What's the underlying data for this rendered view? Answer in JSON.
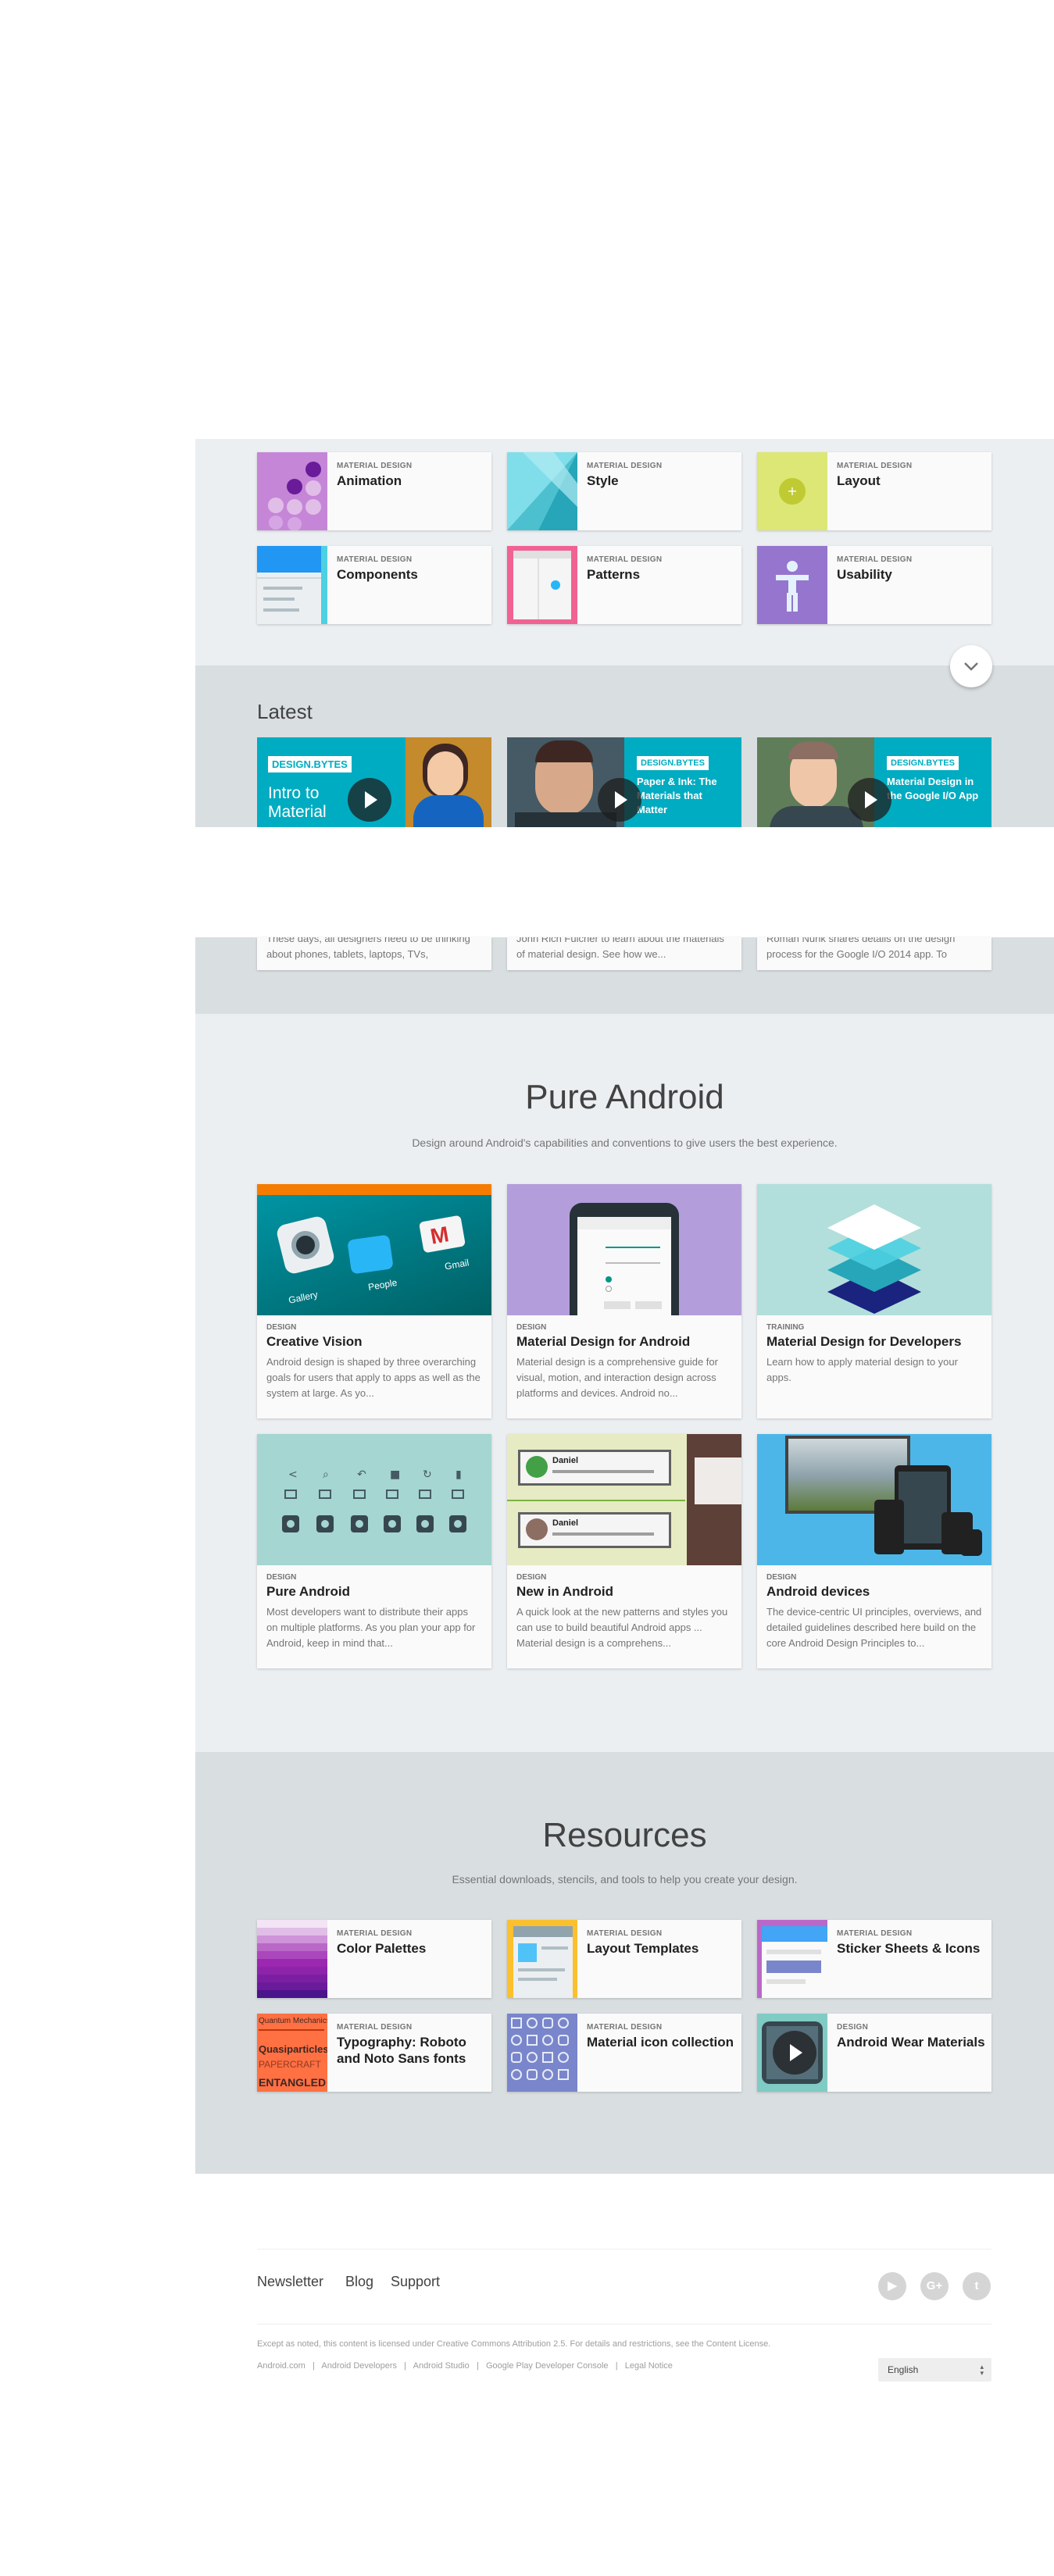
{
  "overview": {
    "cards": [
      {
        "kicker": "MATERIAL DESIGN",
        "title": "Animation"
      },
      {
        "kicker": "MATERIAL DESIGN",
        "title": "Style"
      },
      {
        "kicker": "MATERIAL DESIGN",
        "title": "Layout"
      },
      {
        "kicker": "MATERIAL DESIGN",
        "title": "Components"
      },
      {
        "kicker": "MATERIAL DESIGN",
        "title": "Patterns"
      },
      {
        "kicker": "MATERIAL DESIGN",
        "title": "Usability"
      }
    ]
  },
  "latest": {
    "heading": "Latest",
    "cards": [
      {
        "tag": "DESIGN.BYTES",
        "overlay": "Intro to Material",
        "snippet": "These days, all designers need to be thinking about phones, tablets, laptops, TVs,"
      },
      {
        "tag": "DESIGN.BYTES",
        "overlay": "Paper & Ink: The Materials that Matter",
        "snippet": "John Rich Fulcher to learn about the materials of material design. See how we..."
      },
      {
        "tag": "DESIGN.BYTES",
        "overlay": "Material Design in the Google I/O App",
        "snippet": "Roman Nurik shares details on the design process for the Google I/O 2014 app. To"
      }
    ]
  },
  "pure_android": {
    "title": "Pure Android",
    "subtitle": "Design around Android's capabilities and conventions to give users the best experience.",
    "cards": [
      {
        "kicker": "DESIGN",
        "title": "Creative Vision",
        "desc": "Android design is shaped by three overarching goals for users that apply to apps as well as the system at large. As yo..."
      },
      {
        "kicker": "DESIGN",
        "title": "Material Design for Android",
        "desc": "Material design is a comprehensive guide for visual, motion, and interaction design across platforms and devices. Android no..."
      },
      {
        "kicker": "TRAINING",
        "title": "Material Design for Developers",
        "desc": "Learn how to apply material design to your apps."
      },
      {
        "kicker": "DESIGN",
        "title": "Pure Android",
        "desc": "Most developers want to distribute their apps on multiple platforms. As you plan your app for Android, keep in mind that..."
      },
      {
        "kicker": "DESIGN",
        "title": "New in Android",
        "desc": "A quick look at the new patterns and styles you can use to build beautiful Android apps ... Material design is a comprehens..."
      },
      {
        "kicker": "DESIGN",
        "title": "Android devices",
        "desc": "The device-centric UI principles, overviews, and detailed guidelines described here build on the core Android Design Principles to..."
      }
    ],
    "img_labels": {
      "gallery": "Gallery",
      "people": "People",
      "gmail": "Gmail",
      "sender": "Daniel"
    }
  },
  "resources": {
    "title": "Resources",
    "subtitle": "Essential downloads, stencils, and tools to help you create your design.",
    "cards": [
      {
        "kicker": "MATERIAL DESIGN",
        "title": "Color Palettes"
      },
      {
        "kicker": "MATERIAL DESIGN",
        "title": "Layout Templates"
      },
      {
        "kicker": "MATERIAL DESIGN",
        "title": "Sticker Sheets & Icons"
      },
      {
        "kicker": "MATERIAL DESIGN",
        "title": "Typography: Roboto and Noto Sans fonts"
      },
      {
        "kicker": "MATERIAL DESIGN",
        "title": "Material icon collection"
      },
      {
        "kicker": "DESIGN",
        "title": "Android Wear Materials"
      }
    ],
    "typo_words": [
      "Quantum Mechanics",
      "Quasiparticles",
      "PAPERCRAFT",
      "ENTANGLED"
    ]
  },
  "footer": {
    "links": [
      "Newsletter",
      "Blog",
      "Support"
    ],
    "social": [
      {
        "icon": "youtube-icon",
        "glyph": "▶"
      },
      {
        "icon": "google-plus-icon",
        "glyph": "G+"
      },
      {
        "icon": "twitter-icon",
        "glyph": "t"
      }
    ],
    "license": "Except as noted, this content is licensed under Creative Commons Attribution 2.5. For details and restrictions, see the Content License.",
    "sublinks": [
      "Android.com",
      "Android Developers",
      "Android Studio",
      "Google Play Developer Console",
      "Legal Notice"
    ],
    "language": "English"
  },
  "colors": {
    "page_bg": "#eceff1",
    "latest_bg": "#d9dee1",
    "accent_teal": "#00acc1"
  }
}
